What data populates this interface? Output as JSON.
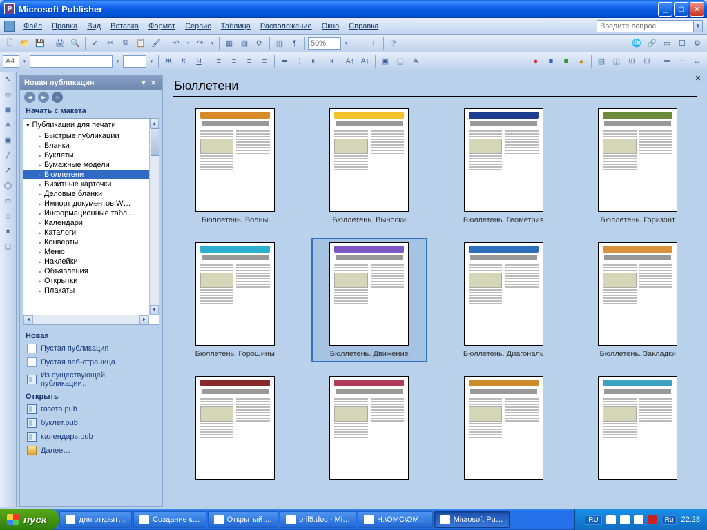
{
  "titlebar": {
    "title": "Microsoft Publisher"
  },
  "menu": {
    "items": [
      {
        "label": "Файл"
      },
      {
        "label": "Правка"
      },
      {
        "label": "Вид"
      },
      {
        "label": "Вставка"
      },
      {
        "label": "Формат"
      },
      {
        "label": "Сервис"
      },
      {
        "label": "Таблица"
      },
      {
        "label": "Расположение"
      },
      {
        "label": "Окно"
      },
      {
        "label": "Справка"
      }
    ],
    "ask_placeholder": "Введите вопрос"
  },
  "toolbar2": {
    "zoom": "50%",
    "font_hint": "A4"
  },
  "taskpane": {
    "title": "Новая публикация",
    "section_start": "Начать с макета",
    "tree_root": "Публикации для печати",
    "tree_items": [
      "Быстрые публикации",
      "Бланки",
      "Буклеты",
      "Бумажные модели",
      "Бюллетени",
      "Визитные карточки",
      "Деловые бланки",
      "Импорт документов W…",
      "Информационные табл…",
      "Календари",
      "Каталоги",
      "Конверты",
      "Меню",
      "Наклейки",
      "Объявления",
      "Открытки",
      "Плакаты"
    ],
    "tree_selected_index": 4,
    "section_new": "Новая",
    "new_links": [
      "Пустая публикация",
      "Пустая веб-страница",
      "Из существующей публикации…"
    ],
    "section_open": "Открыть",
    "open_links": [
      "газета.pub",
      "буклет.pub",
      "календарь.pub",
      "Далее…"
    ]
  },
  "gallery": {
    "title": "Бюллетени",
    "selected_index": 5,
    "items": [
      {
        "label": "Бюллетень. Волны",
        "accent": "#d98a28"
      },
      {
        "label": "Бюллетень. Выноски",
        "accent": "#f2c028"
      },
      {
        "label": "Бюллетень. Геометрия",
        "accent": "#1c3d8e"
      },
      {
        "label": "Бюллетень. Горизонт",
        "accent": "#6b8b3a"
      },
      {
        "label": "Бюллетень. Горошины",
        "accent": "#2baed0"
      },
      {
        "label": "Бюллетень. Движение",
        "accent": "#7a57c2"
      },
      {
        "label": "Бюллетень. Диагональ",
        "accent": "#2e6fbd"
      },
      {
        "label": "Бюллетень. Закладки",
        "accent": "#d9913a"
      },
      {
        "label": "",
        "accent": "#8b2a2a"
      },
      {
        "label": "",
        "accent": "#b33a5a"
      },
      {
        "label": "",
        "accent": "#cc8a2a"
      },
      {
        "label": "",
        "accent": "#3aa2c2"
      }
    ]
  },
  "taskbar": {
    "start": "пуск",
    "tasks": [
      {
        "label": "для открыт…"
      },
      {
        "label": "Создание к…"
      },
      {
        "label": "Открытый …"
      },
      {
        "label": "pril5.doc - Mi…"
      },
      {
        "label": "H:\\ОМС\\ОМ…"
      },
      {
        "label": "Microsoft Pu…"
      }
    ],
    "active_index": 5,
    "lang1": "RU",
    "lang2": "Ru",
    "clock": "22:28"
  }
}
